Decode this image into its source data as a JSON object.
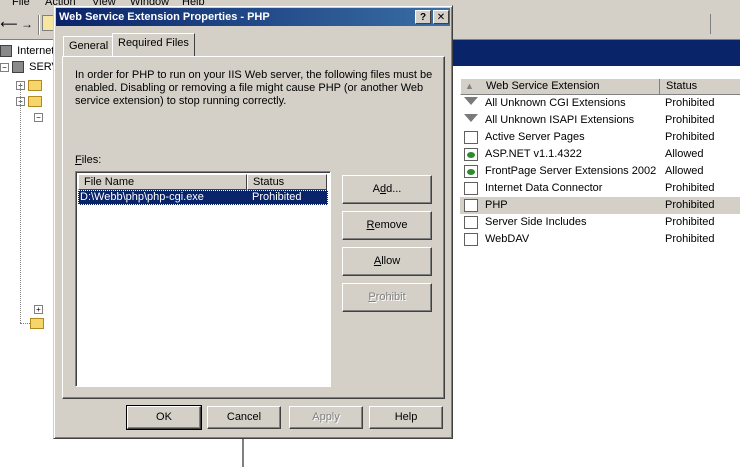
{
  "background": {
    "menu": [
      "File",
      "Action",
      "View",
      "Window",
      "Help"
    ],
    "tree": {
      "root_label": "Internet",
      "server_label": "SERV"
    },
    "extensions": {
      "columns": [
        "Web Service Extension",
        "Status"
      ],
      "rows": [
        {
          "name": "All Unknown CGI Extensions",
          "status": "Prohibited",
          "icon": "filter-icon"
        },
        {
          "name": "All Unknown ISAPI Extensions",
          "status": "Prohibited",
          "icon": "filter-icon"
        },
        {
          "name": "Active Server Pages",
          "status": "Prohibited",
          "icon": "document-icon"
        },
        {
          "name": "ASP.NET v1.1.4322",
          "status": "Allowed",
          "icon": "allowed-document-icon"
        },
        {
          "name": "FrontPage Server Extensions 2002",
          "status": "Allowed",
          "icon": "allowed-document-icon"
        },
        {
          "name": "Internet Data Connector",
          "status": "Prohibited",
          "icon": "document-icon"
        },
        {
          "name": "PHP",
          "status": "Prohibited",
          "icon": "document-icon"
        },
        {
          "name": "Server Side Includes",
          "status": "Prohibited",
          "icon": "document-icon"
        },
        {
          "name": "WebDAV",
          "status": "Prohibited",
          "icon": "document-icon"
        }
      ],
      "selected_name": "PHP"
    }
  },
  "dialog": {
    "title": "Web Service Extension Properties - PHP",
    "help_glyph": "?",
    "close_glyph": "✕",
    "tabs": [
      "General",
      "Required Files"
    ],
    "active_tab": "Required Files",
    "intro_text": "In order for PHP to run on your IIS Web server, the following files must be enabled.  Disabling or removing a file might cause PHP (or another Web service extension) to stop running correctly.",
    "files_label_accel": "F",
    "files_label_rest": "iles:",
    "files_table": {
      "columns": [
        "File Name",
        "Status"
      ],
      "rows": [
        {
          "file": "D:\\Webb\\php\\php-cgi.exe",
          "status": "Prohibited"
        }
      ]
    },
    "side_buttons": {
      "add": {
        "accel": "d",
        "before": "A",
        "after": "d..."
      },
      "remove": {
        "accel": "R",
        "rest": "emove"
      },
      "allow": {
        "accel": "A",
        "rest": "llow"
      },
      "prohibit": {
        "accel": "P",
        "rest": "rohibit"
      }
    },
    "bottom_buttons": {
      "ok": "OK",
      "cancel": "Cancel",
      "apply": "Apply",
      "help": "Help"
    }
  }
}
